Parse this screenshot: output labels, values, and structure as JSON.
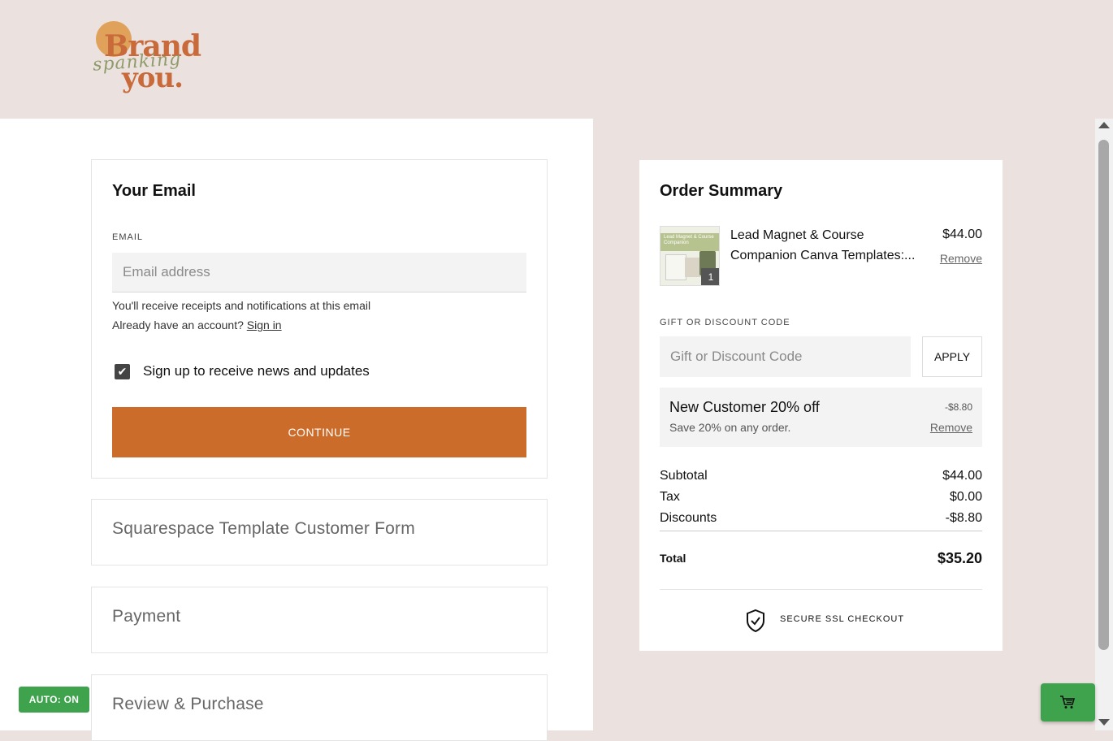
{
  "logo": {
    "line1": "Brand",
    "line2": "spanking",
    "line3": "you."
  },
  "email_section": {
    "title": "Your Email",
    "label": "EMAIL",
    "placeholder": "Email address",
    "value": "",
    "note": "You'll receive receipts and notifications at this email",
    "account_prompt": "Already have an account?",
    "sign_in": "Sign in",
    "newsletter_label": "Sign up to receive news and updates",
    "newsletter_checked": true,
    "continue_label": "CONTINUE"
  },
  "steps": [
    {
      "label": "Squarespace Template Customer Form"
    },
    {
      "label": "Payment"
    },
    {
      "label": "Review & Purchase"
    }
  ],
  "order_summary": {
    "title": "Order Summary",
    "item": {
      "name_line1": "Lead Magnet & Course",
      "name_line2": "Companion Canva Templates:...",
      "thumb_text": "Lead Magnet & Course Companion",
      "quantity": "1",
      "price": "$44.00",
      "remove": "Remove"
    },
    "discount_label": "GIFT OR DISCOUNT CODE",
    "discount_placeholder": "Gift or Discount Code",
    "apply_label": "APPLY",
    "promo": {
      "title": "New Customer 20% off",
      "amount": "-$8.80",
      "description": "Save 20% on any order.",
      "remove": "Remove"
    },
    "totals": {
      "subtotal_label": "Subtotal",
      "subtotal": "$44.00",
      "tax_label": "Tax",
      "tax": "$0.00",
      "discounts_label": "Discounts",
      "discounts": "-$8.80",
      "total_label": "Total",
      "total": "$35.20"
    },
    "secure_label": "SECURE SSL CHECKOUT"
  },
  "overlay": {
    "auto_badge": "AUTO: ON"
  },
  "colors": {
    "accent": "#cc6c2a",
    "background": "#ebe2df",
    "badge_green": "#3fa34d"
  }
}
